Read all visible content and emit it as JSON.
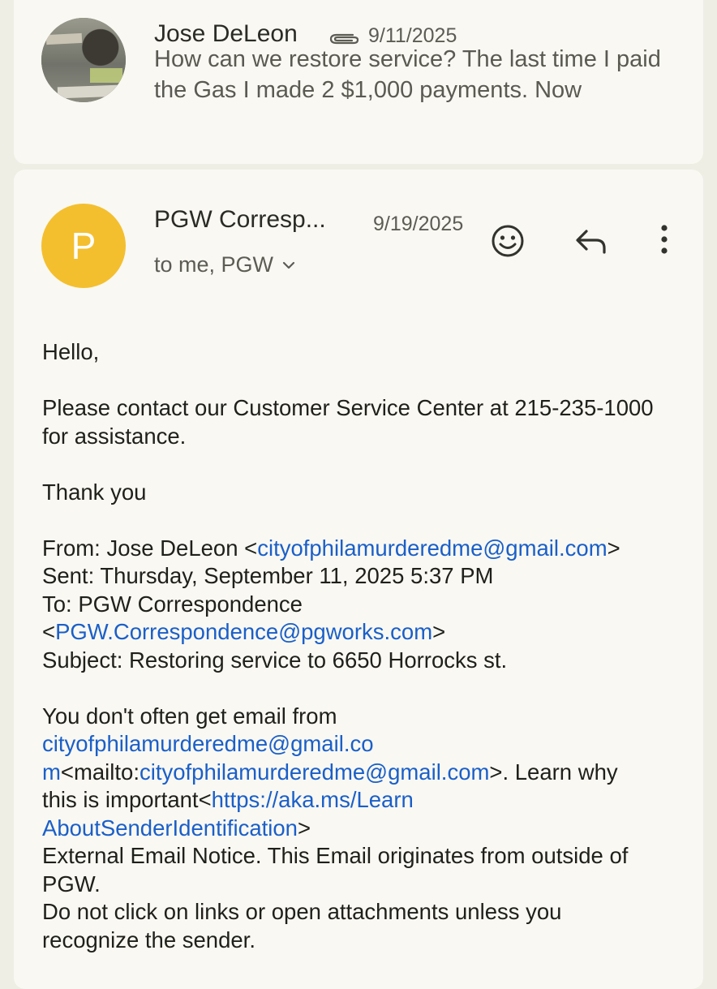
{
  "thread": [
    {
      "sender": "Jose DeLeon",
      "date": "9/11/2025",
      "has_attachment": true,
      "snippet": "How can we restore service? The last time I paid the Gas I made 2 $1,000 payments. Now",
      "avatar": "photo"
    },
    {
      "sender": "PGW Corresp...",
      "date": "9/19/2025",
      "avatar_letter": "P",
      "avatar_color": "#f4bf2e",
      "recipients": "to me, PGW",
      "actions": [
        "emoji-react-icon",
        "reply-icon",
        "more-vert-icon"
      ],
      "body": {
        "greeting": "Hello,",
        "contact_line": "Please contact our Customer Service Center at 215-235-1000 for assistance.",
        "thanks": "Thank you",
        "quoted": {
          "from_label": "From: Jose DeLeon <",
          "from_email": "cityofphilamurderedme@gmail.com",
          "from_end": ">",
          "sent": "Sent: Thursday, September 11, 2025 5:37 PM",
          "to_label": "To: PGW Correspondence",
          "to_open": "<",
          "to_email": "PGW.Correspondence@pgworks.com",
          "to_end": ">",
          "subject": "Subject: Restoring service to 6650 Horrocks st."
        },
        "warning": {
          "intro": "You don't often get email from",
          "link1a": "cityofphilamurderedme@gmail.co",
          "link1b": "m",
          "mailto_label": "<mailto:",
          "mailto_email": "cityofphilamurderedme@gmail.com",
          "mailto_end": ">. Learn why",
          "important": "this is important<",
          "learn_url_a": "https://aka.ms/Learn",
          "learn_url_b": "AboutSenderIdentification",
          "learn_end": ">",
          "external_a": "External Email Notice. This Email originates from outside of",
          "external_b": "PGW.",
          "caution_a": "Do not click on links or open attachments unless you",
          "caution_b": "recognize the sender."
        }
      }
    }
  ],
  "colors": {
    "background": "#efeee5",
    "card": "#f9f8f2",
    "link": "#1a5fc9",
    "text_secondary": "#5c5c55"
  }
}
